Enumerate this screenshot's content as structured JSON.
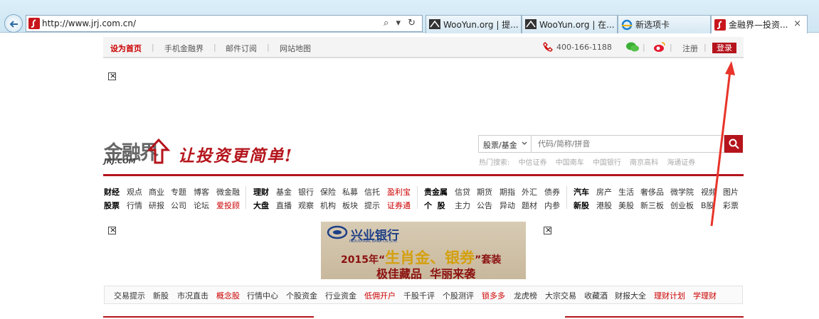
{
  "browser": {
    "url": "http://www.jrj.com.cn/",
    "address_tools": "⌕ ▾ ↻",
    "tabs": [
      {
        "label": "WooYun.org | 提..."
      },
      {
        "label": "WooYun.org | 在..."
      },
      {
        "label": "新选项卡"
      },
      {
        "label": "金融界—投资..."
      }
    ],
    "close_glyph": "×"
  },
  "topbar": {
    "home_label": "设为首页",
    "mobile_label": "手机金融界",
    "mail_label": "邮件订阅",
    "sitemap_label": "网站地图",
    "phone": "400-166-1188",
    "register_label": "注册",
    "login_label": "登录",
    "sep": "|"
  },
  "logo": {
    "main": "金融界",
    "sub": "JRJ.COM",
    "slogan": "让投资更简单!"
  },
  "search": {
    "category": "股票/基金",
    "placeholder": "代码/简称/拼音",
    "hot_label": "热门搜索:",
    "hot_items": [
      "中信证券",
      "中国南车",
      "中国银行",
      "南京高科",
      "海通证券"
    ]
  },
  "nav": {
    "row1": [
      "财经",
      "观点",
      "商业",
      "专题",
      "博客",
      "微金融",
      "理财",
      "基金",
      "银行",
      "保险",
      "私募",
      "信托",
      "盈利宝",
      "贵金属",
      "信贷",
      "期货",
      "期指",
      "外汇",
      "债券",
      "汽车",
      "房产",
      "生活",
      "奢侈品",
      "微学院",
      "视频",
      "图片"
    ],
    "row2": [
      "股票",
      "行情",
      "研报",
      "公司",
      "论坛",
      "爱投顾",
      "大盘",
      "直播",
      "观察",
      "机构",
      "板块",
      "提示",
      "证券通",
      "个  股",
      "主力",
      "公告",
      "异动",
      "题材",
      "内参",
      "新股",
      "港股",
      "美股",
      "新三板",
      "创业板",
      "B股",
      "彩票"
    ]
  },
  "banner": {
    "bank_name": "兴业银行",
    "bank_en": "INDUSTRIAL BANK CO.,LTD.",
    "line1_prefix": "2015年“",
    "line1_highlight": "生肖金、银券",
    "line1_suffix": "”套装",
    "line2": "极佳藏品  华丽来袭"
  },
  "bottom_nav": [
    "交易提示",
    "新股",
    "市况直击",
    "概念股",
    "行情中心",
    "个股资金",
    "行业资金",
    "低佣开户",
    "千股千评",
    "个股测评",
    "锁多多",
    "龙虎榜",
    "大宗交易",
    "收藏酒",
    "财报大全",
    "理财计划",
    "学理财"
  ],
  "colors": {
    "brand_red": "#b5141c",
    "annotation_arrow": "#e8342a"
  }
}
